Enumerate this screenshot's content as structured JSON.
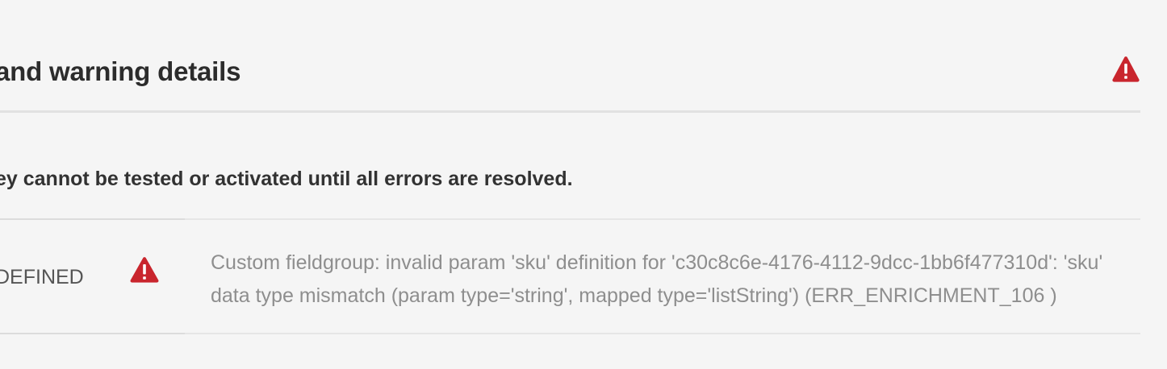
{
  "panel": {
    "title": "and warning details",
    "notice": "ey cannot be tested or activated until all errors are resolved.",
    "status_color": "#c9252d",
    "header_icon": "alert-triangle-icon"
  },
  "rows": [
    {
      "type": "DEFINED",
      "severity_icon": "alert-triangle-icon",
      "message": "Custom fieldgroup: invalid param 'sku' definition for 'c30c8c6e-4176-4112-9dcc-1bb6f477310d': 'sku' data type mismatch (param type='string', mapped type='listString') (ERR_ENRICHMENT_106 )"
    }
  ]
}
